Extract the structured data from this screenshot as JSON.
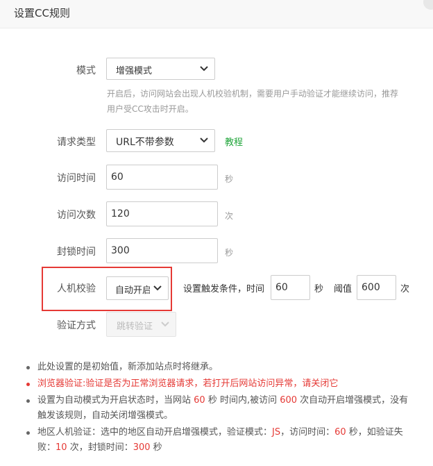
{
  "header": {
    "title": "设置CC规则"
  },
  "form": {
    "mode": {
      "label": "模式",
      "value": "增强模式",
      "help": "开启后，访问网站会出现人机校验机制，需要用户手动验证才能继续访问，推荐用户受CC攻击时开启。"
    },
    "request_type": {
      "label": "请求类型",
      "value": "URL不带参数",
      "tutorial": "教程"
    },
    "visit_time": {
      "label": "访问时间",
      "value": "60",
      "unit": "秒"
    },
    "visit_count": {
      "label": "访问次数",
      "value": "120",
      "unit": "次"
    },
    "block_time": {
      "label": "封锁时间",
      "value": "300",
      "unit": "秒"
    },
    "captcha": {
      "label": "人机校验",
      "value": "自动开启",
      "trigger_label": "设置触发条件，时间",
      "time_value": "60",
      "time_unit": "秒",
      "threshold_label": "阈值",
      "threshold_value": "600",
      "threshold_unit": "次"
    },
    "verify_method": {
      "label": "验证方式",
      "value": "跳转验证"
    }
  },
  "notes": {
    "n1": "此处设置的是初始值，新添加站点时将继承。",
    "n2": "浏览器验证:验证是否为正常浏览器请求，若打开后网站访问异常，请关闭它",
    "n3": {
      "a": "设置为自动模式为开启状态时，当网站 ",
      "v1": "60",
      "b": " 秒 时间内,被访问 ",
      "v2": "600",
      "c": " 次自动开启增强模式，没有触发该规则，自动关闭增强模式。"
    },
    "n4": {
      "a": "地区人机验证：选中的地区自动开启增强模式，验证模式：",
      "v1": "JS",
      "b": "，访问时间：",
      "v2": "60",
      "c": " 秒，如验证失败：",
      "v3": "10",
      "d": " 次，封锁时间：",
      "v4": "300",
      "e": " 秒"
    }
  },
  "colors": {
    "accent_green": "#20a53a",
    "highlight_red": "#e53935"
  }
}
